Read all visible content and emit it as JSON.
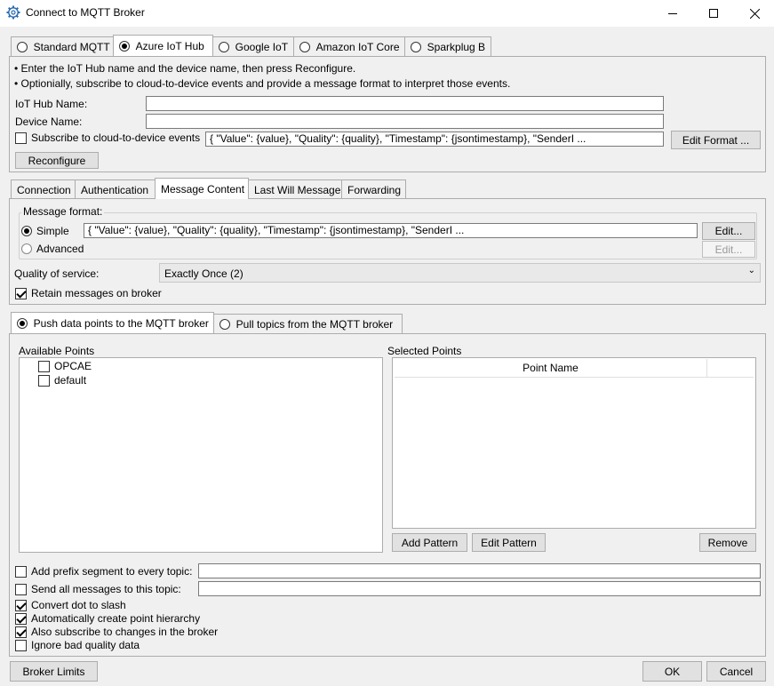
{
  "window": {
    "title": "Connect to MQTT Broker"
  },
  "provider_tabs": [
    {
      "label": "Standard MQTT",
      "selected": false
    },
    {
      "label": "Azure IoT Hub",
      "selected": true
    },
    {
      "label": "Google IoT",
      "selected": false
    },
    {
      "label": "Amazon IoT Core",
      "selected": false
    },
    {
      "label": "Sparkplug B",
      "selected": false
    }
  ],
  "azure": {
    "bullet1": "Enter the IoT Hub name and the device name, then press Reconfigure.",
    "bullet2": "Optionially, subscribe to cloud-to-device events and provide a message format to interpret those events.",
    "hub_name_label": "IoT Hub Name:",
    "hub_name_value": "",
    "device_name_label": "Device Name:",
    "device_name_value": "",
    "subscribe_label": "Subscribe to cloud-to-device events",
    "subscribe_checked": false,
    "event_format": "{ \"Value\": {value}, \"Quality\": {quality}, \"Timestamp\": {jsontimestamp}, \"SenderI ...",
    "edit_format_button": "Edit Format ...",
    "reconfigure_button": "Reconfigure"
  },
  "settings_tabs": [
    {
      "label": "Connection",
      "selected": false
    },
    {
      "label": "Authentication",
      "selected": false
    },
    {
      "label": "Message Content",
      "selected": true
    },
    {
      "label": "Last Will Message",
      "selected": false
    },
    {
      "label": "Forwarding",
      "selected": false
    }
  ],
  "message_content": {
    "format_group_label": "Message format:",
    "simple_label": "Simple",
    "simple_selected": true,
    "simple_value": "{ \"Value\": {value}, \"Quality\": {quality}, \"Timestamp\": {jsontimestamp}, \"SenderI ...",
    "simple_edit_button": "Edit...",
    "advanced_label": "Advanced",
    "advanced_edit_button": "Edit...",
    "qos_label": "Quality of service:",
    "qos_value": "Exactly Once (2)",
    "retain_label": "Retain messages on broker",
    "retain_checked": true
  },
  "direction_tabs": [
    {
      "label": "Push data points to the MQTT broker",
      "selected": true
    },
    {
      "label": "Pull topics from the MQTT broker",
      "selected": false
    }
  ],
  "push": {
    "available_label": "Available Points",
    "available_items": [
      {
        "label": "OPCAE",
        "checked": false
      },
      {
        "label": "default",
        "checked": false
      }
    ],
    "selected_label": "Selected Points",
    "selected_column": "Point Name",
    "add_pattern_button": "Add Pattern",
    "edit_pattern_button": "Edit Pattern",
    "remove_button": "Remove",
    "prefix_label": "Add prefix segment to every topic:",
    "prefix_checked": false,
    "prefix_value": "",
    "send_all_label": "Send all messages to this topic:",
    "send_all_checked": false,
    "send_all_value": "",
    "options": [
      {
        "label": "Convert dot to slash",
        "checked": true
      },
      {
        "label": "Automatically create point hierarchy",
        "checked": true
      },
      {
        "label": "Also subscribe to changes in the broker",
        "checked": true
      },
      {
        "label": "Ignore bad quality data",
        "checked": false
      }
    ]
  },
  "footer": {
    "broker_limits_button": "Broker Limits",
    "ok_button": "OK",
    "cancel_button": "Cancel"
  }
}
